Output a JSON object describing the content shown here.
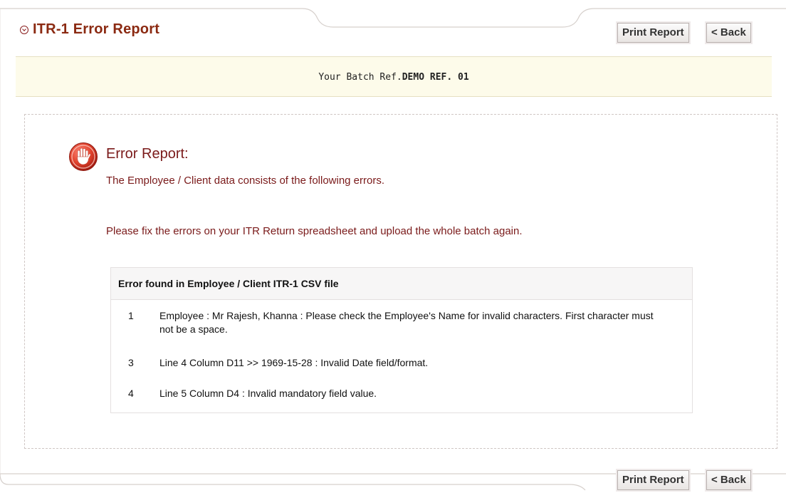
{
  "header": {
    "title": "ITR-1 Error Report",
    "icon": "circle-arrow-icon"
  },
  "buttons": {
    "print_label": "Print Report",
    "back_label": "< Back"
  },
  "banner": {
    "prefix": "Your Batch Ref.",
    "ref": "DEMO REF. 01"
  },
  "error_report": {
    "heading": "Error Report:",
    "subtitle": "The Employee / Client data consists of the following errors.",
    "instruction": "Please fix the errors on your ITR Return spreadsheet and upload the whole batch again.",
    "icon": "stop-hand-icon"
  },
  "table": {
    "header": "Error found in Employee / Client ITR-1 CSV file",
    "rows": [
      {
        "num": "1",
        "message": "Employee : Mr  Rajesh, Khanna : Please check the Employee's Name for invalid characters. First character must not be a space."
      },
      {
        "num": "3",
        "message": "Line 4 Column D11 >> 1969-15-28 : Invalid Date field/format."
      },
      {
        "num": "4",
        "message": "Line 5 Column D4 : Invalid mandatory field value."
      }
    ]
  },
  "colors": {
    "title": "#8b2a12",
    "error_text": "#7a1a1a",
    "banner_bg": "#fdfbea"
  }
}
